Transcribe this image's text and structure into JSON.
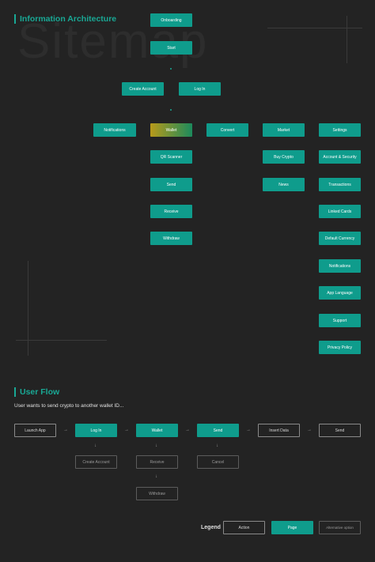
{
  "ia": {
    "title": "Information Architecture",
    "watermark": "Sitemap",
    "onboarding": "Onboarding",
    "start": "Start",
    "create_account": "Create Account",
    "log_in": "Log In",
    "top_level": [
      "Notifications",
      "Wallet",
      "Convert",
      "Market",
      "Settings"
    ],
    "wallet_children": [
      "QR Scanner",
      "Send",
      "Receive",
      "Withdraw"
    ],
    "market_children": [
      "Buy Crypto",
      "News"
    ],
    "settings_children": [
      "Account & Security",
      "Transactions",
      "Linked Cards",
      "Default Currency",
      "Notifications",
      "App Language",
      "Support",
      "Privacy Policy"
    ]
  },
  "flow": {
    "title": "User Flow",
    "subtitle": "User wants to send crypto to another wallet ID...",
    "steps": [
      "Launch App",
      "Log In",
      "Wallet",
      "Send",
      "Insert Data",
      "Send"
    ],
    "alternatives": {
      "create_account": "Create Account",
      "receive": "Receive",
      "cancel": "Cancel",
      "withdraw": "Withdraw"
    },
    "arrow_glyph": "→",
    "down_glyph": "↓"
  },
  "legend": {
    "label": "Legend",
    "action": "Action",
    "page": "Page",
    "alternative": "Alternative option"
  }
}
